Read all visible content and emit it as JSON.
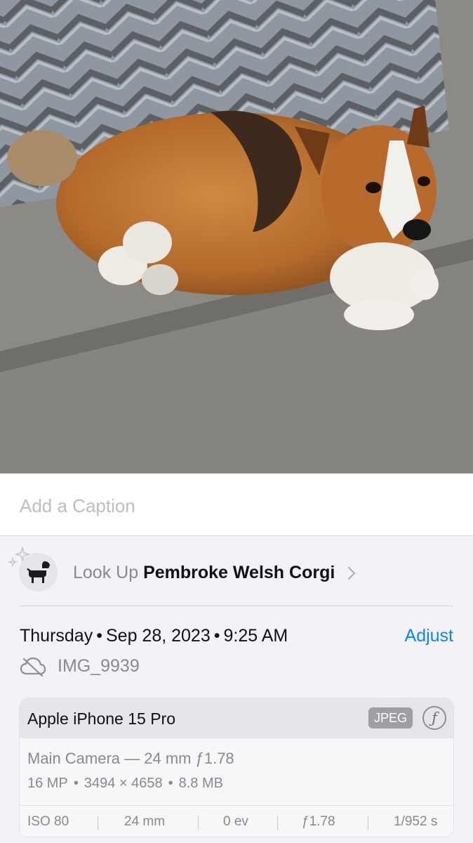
{
  "caption": {
    "placeholder": "Add a Caption"
  },
  "lookup": {
    "prefix": "Look Up",
    "name": "Pembroke Welsh Corgi"
  },
  "date": {
    "day": "Thursday",
    "date": "Sep 28, 2023",
    "time": "9:25 AM"
  },
  "adjust_label": "Adjust",
  "file": {
    "name": "IMG_9939"
  },
  "camera": {
    "device": "Apple iPhone 15 Pro",
    "format": "JPEG",
    "format_icon": "ƒ",
    "lens": "Main Camera — 24 mm ƒ1.78",
    "resolution": "16 MP",
    "dimensions": "3494 × 4658",
    "size": "8.8 MB",
    "exif": {
      "iso": "ISO 80",
      "focal": "24 mm",
      "ev": "0 ev",
      "aperture": "ƒ1.78",
      "shutter": "1/952 s"
    }
  },
  "separator": "•",
  "colors": {
    "accent": "#0a84ff"
  },
  "icons": [
    "sparkle-icon",
    "dog-icon",
    "chevron-right-icon",
    "cloud-off-icon",
    "aperture-f-icon"
  ]
}
